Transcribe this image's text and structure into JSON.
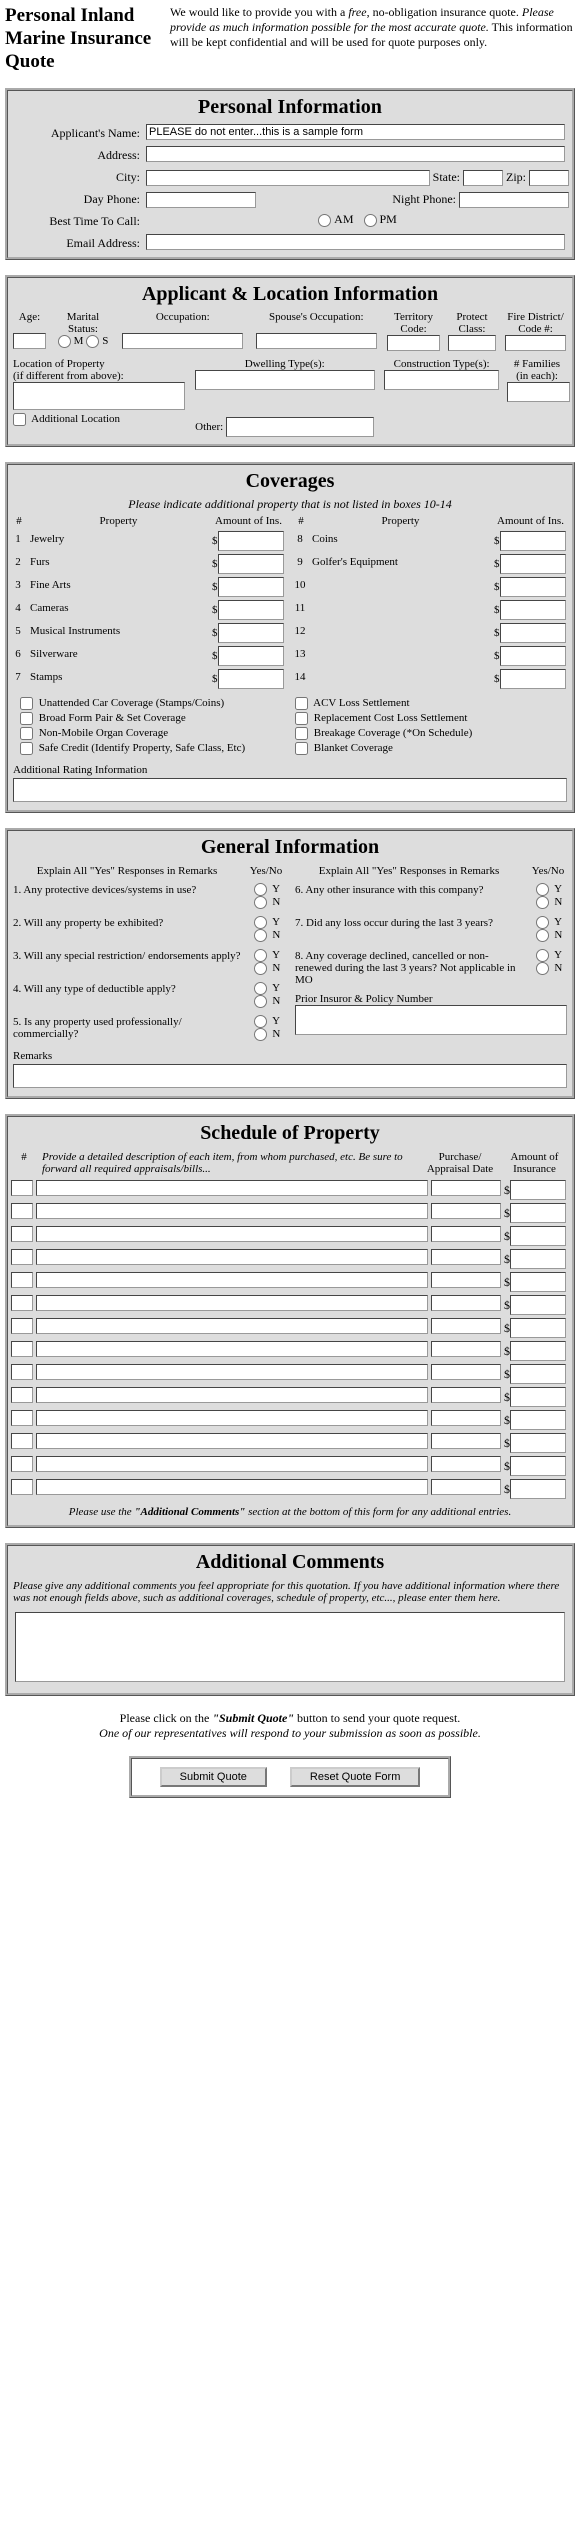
{
  "header": {
    "title": "Personal Inland Marine Insurance Quote",
    "desc_pre": "We would like to provide you with a ",
    "desc_em1": "free",
    "desc_mid": ", no-obligation insurance quote. ",
    "desc_em2": "Please provide as much information possible for the most accurate quote.",
    "desc_post": " This information will be kept confidential and will be used for quote purposes only."
  },
  "s1": {
    "title": "Personal Information",
    "fields": {
      "name": "Applicant's Name:",
      "name_val": "PLEASE do not enter...this is a sample form",
      "addr": "Address:",
      "city": "City:",
      "state": "State:",
      "zip": "Zip:",
      "dayphone": "Day Phone:",
      "nightphone": "Night Phone:",
      "besttime": "Best Time To Call:",
      "am": "AM",
      "pm": "PM",
      "email": "Email Address:"
    }
  },
  "s2": {
    "title": "Applicant & Location Information",
    "cols": [
      "Age:",
      "Marital Status:",
      "Occupation:",
      "Spouse's Occupation:",
      "Territory Code:",
      "Protect Class:",
      "Fire District/ Code #:"
    ],
    "m": "M",
    "s": "S",
    "loc": "Location of Property",
    "loc2": "(if different from above):",
    "addl": "Additional Location",
    "dwell": "Dwelling Type(s):",
    "constr": "Construction Type(s):",
    "fam": "# Families (in each):",
    "other": "Other:"
  },
  "s3": {
    "title": "Coverages",
    "note": "Please indicate additional property that is not listed in boxes 10-14",
    "h_num": "#",
    "h_prop": "Property",
    "h_amt": "Amount of Ins.",
    "left": [
      {
        "n": "1",
        "p": "Jewelry"
      },
      {
        "n": "2",
        "p": "Furs"
      },
      {
        "n": "3",
        "p": "Fine Arts"
      },
      {
        "n": "4",
        "p": "Cameras"
      },
      {
        "n": "5",
        "p": "Musical Instruments"
      },
      {
        "n": "6",
        "p": "Silverware"
      },
      {
        "n": "7",
        "p": "Stamps"
      }
    ],
    "right": [
      {
        "n": "8",
        "p": "Coins"
      },
      {
        "n": "9",
        "p": "Golfer's Equipment"
      },
      {
        "n": "10",
        "p": ""
      },
      {
        "n": "11",
        "p": ""
      },
      {
        "n": "12",
        "p": ""
      },
      {
        "n": "13",
        "p": ""
      },
      {
        "n": "14",
        "p": ""
      }
    ],
    "dollar": "$",
    "checks_l": [
      "Unattended Car Coverage (Stamps/Coins)",
      "Broad Form Pair & Set Coverage",
      "Non-Mobile Organ Coverage",
      "Safe Credit (Identify Property, Safe Class, Etc)"
    ],
    "checks_r": [
      "ACV Loss Settlement",
      "Replacement Cost Loss Settlement",
      "Breakage Coverage (*On Schedule)",
      "Blanket Coverage"
    ],
    "addl_rating": "Additional Rating Information"
  },
  "s4": {
    "title": "General Information",
    "h_explain": "Explain All \"Yes\" Responses in Remarks",
    "h_yn": "Yes/No",
    "y": "Y",
    "n": "N",
    "left": [
      "1. Any protective devices/systems in use?",
      "2. Will any property be exhibited?",
      "3. Will any special restriction/ endorsements apply?",
      "4. Will any type of deductible apply?",
      "5. Is any property used professionally/ commercially?"
    ],
    "right": [
      "6. Any other insurance with this company?",
      "7. Did any loss occur during the last 3 years?",
      "8. Any coverage declined, cancelled or non-renewed during the last 3 years? Not applicable in MO"
    ],
    "prior": "Prior Insuror & Policy Number",
    "remarks": "Remarks"
  },
  "s5": {
    "title": "Schedule of Property",
    "h_num": "#",
    "h_desc": "Provide a detailed description of each item, from whom purchased, etc. Be sure to forward all required appraisals/bills...",
    "h_date": "Purchase/ Appraisal Date",
    "h_amt": "Amount of Insurance",
    "dollar": "$",
    "rows": 14,
    "note_pre": "Please use the ",
    "note_b": "\"Additional Comments\"",
    "note_post": " section at the bottom of this form for any additional entries."
  },
  "s6": {
    "title": "Additional Comments",
    "note": "Please give any additional comments you feel appropriate for this quotation. If you have additional information where there was not enough fields above, such as additional coverages, schedule of property, etc..., please enter them here."
  },
  "footer": {
    "pre": "Please click on the ",
    "b": "\"Submit Quote\"",
    "mid": " button to send your quote request.",
    "em": "One of our representatives will respond to your submission as soon as possible.",
    "submit": "Submit Quote",
    "reset": "Reset Quote Form"
  }
}
